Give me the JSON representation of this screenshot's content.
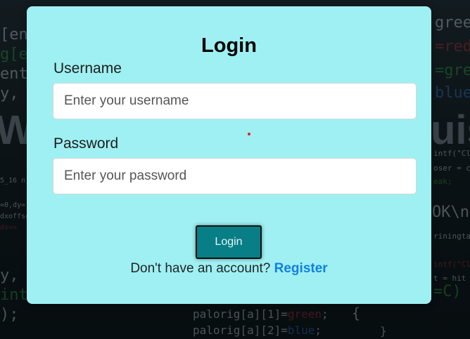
{
  "login": {
    "title": "Login",
    "username_label": "Username",
    "username_placeholder": "Enter your username",
    "password_label": "Password",
    "password_placeholder": "Enter your password",
    "login_button_label": "Login",
    "register_prompt": "Don't have an account?",
    "register_link_label": "Register"
  },
  "colors": {
    "modal_background": "#9ff0f2",
    "login_button": "#087e86",
    "register_link": "#1280e3",
    "page_background": "#0d1417"
  }
}
